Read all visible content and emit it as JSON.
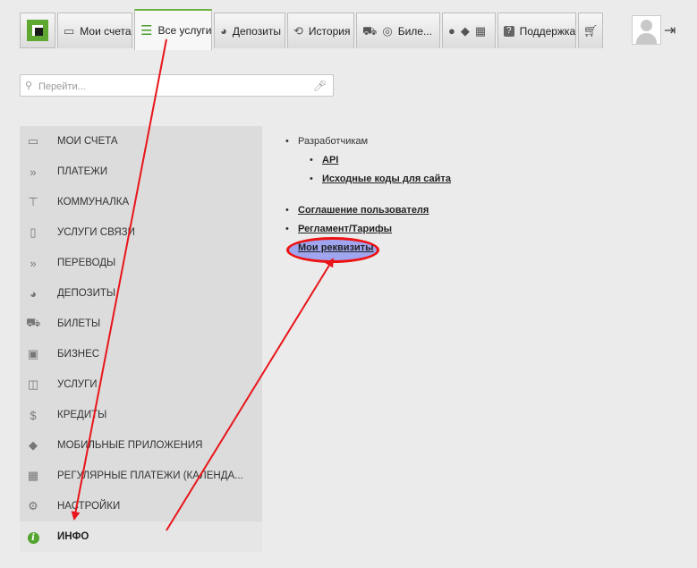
{
  "topbar": {
    "tabs": [
      {
        "label": "Мои счета",
        "icon": "card-icon"
      },
      {
        "label": "Все услуги",
        "icon": "list-icon",
        "active": true
      },
      {
        "label": "Депозиты",
        "icon": "piggy-bank-icon"
      },
      {
        "label": "История",
        "icon": "history-icon"
      },
      {
        "label": "Биле...",
        "icon": "tickets-icon"
      },
      {
        "label": "",
        "icon": "mobile-platforms-icon"
      },
      {
        "label": "Поддержка",
        "icon": "support-icon"
      },
      {
        "label": "",
        "icon": "cart-icon"
      }
    ],
    "accent_color": "#6cb33f"
  },
  "search": {
    "placeholder": "Перейти..."
  },
  "sidebar": {
    "items": [
      {
        "label": "МОИ СЧЕТА",
        "icon": "card-icon"
      },
      {
        "label": "ПЛАТЕЖИ",
        "icon": "double-chevron-icon"
      },
      {
        "label": "КОММУНАЛКА",
        "icon": "faucet-icon"
      },
      {
        "label": "УСЛУГИ СВЯЗИ",
        "icon": "phone-icon"
      },
      {
        "label": "ПЕРЕВОДЫ",
        "icon": "double-chevron-icon"
      },
      {
        "label": "ДЕПОЗИТЫ",
        "icon": "piggy-bank-icon"
      },
      {
        "label": "БИЛЕТЫ",
        "icon": "tickets-icon"
      },
      {
        "label": "БИЗНЕС",
        "icon": "briefcase-icon"
      },
      {
        "label": "УСЛУГИ",
        "icon": "box-icon"
      },
      {
        "label": "КРЕДИТЫ",
        "icon": "money-bag-icon"
      },
      {
        "label": "МОБИЛЬНЫЕ ПРИЛОЖЕНИЯ",
        "icon": "android-icon"
      },
      {
        "label": "РЕГУЛЯРНЫЕ ПЛАТЕЖИ (КАЛЕНДА...",
        "icon": "calendar-icon"
      },
      {
        "label": "НАСТРОЙКИ",
        "icon": "gear-icon"
      },
      {
        "label": "ИНФО",
        "icon": "info-icon",
        "active": true
      }
    ]
  },
  "content": {
    "developers_label": "Разработчикам",
    "api_link": "API",
    "source_link": "Исходные коды для сайта",
    "agreement_link": "Соглашение пользователя",
    "tariffs_link": "Регламент/Тарифы",
    "requisites_link": "Мои реквизиты"
  },
  "annotation": {
    "arrow_color": "#e8151b",
    "highlight_color": "#a0a5f0"
  }
}
